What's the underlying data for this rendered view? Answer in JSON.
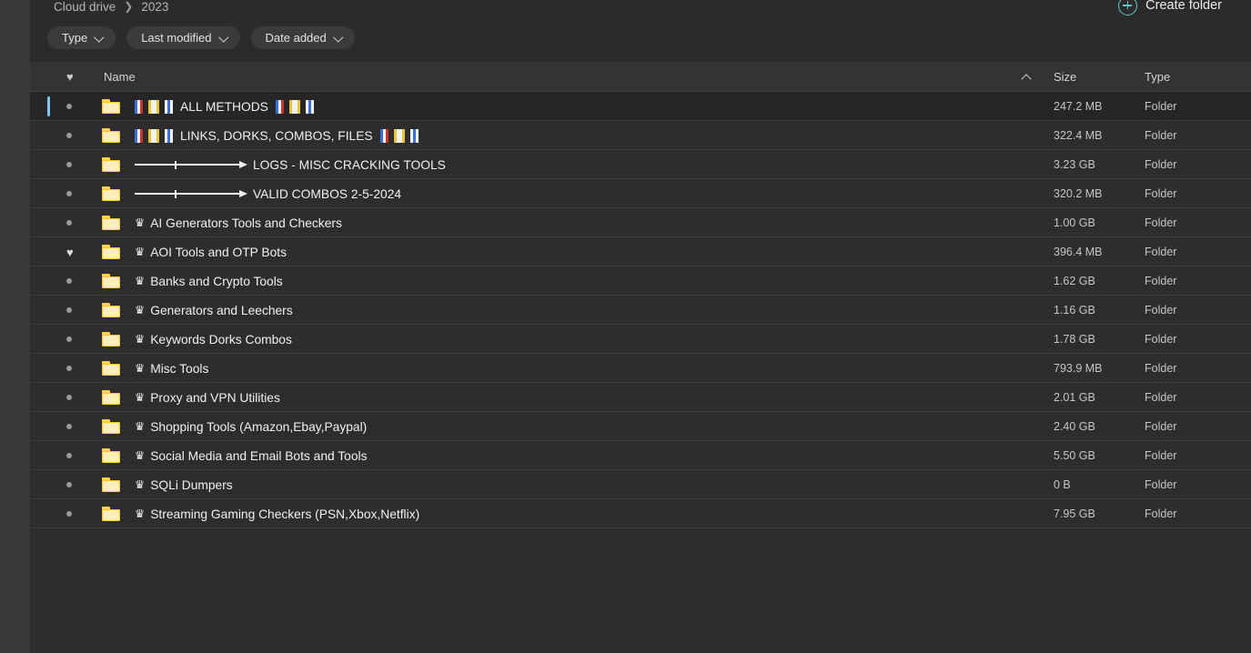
{
  "breadcrumb": {
    "items": [
      "Cloud drive",
      "2023"
    ],
    "separator": "❯"
  },
  "toolbar": {
    "create_folder_label": "Create folder",
    "create_folder_icon": "plus-circle-icon",
    "accent_color": "#5fc8c8"
  },
  "filters": [
    {
      "label": "Type",
      "icon": "chevron-down-icon"
    },
    {
      "label": "Last modified",
      "icon": "chevron-down-icon"
    },
    {
      "label": "Date added",
      "icon": "chevron-down-icon"
    }
  ],
  "table": {
    "columns": {
      "favorite": "♥",
      "name": "Name",
      "size": "Size",
      "type": "Type"
    },
    "sort": {
      "column": "Name",
      "direction": "asc",
      "icon": "caret-up-icon"
    },
    "rows": [
      {
        "name": "ALL METHODS",
        "deco": "flags",
        "favorite": false,
        "selected": true,
        "size": "247.2 MB",
        "type": "Folder"
      },
      {
        "name": "LINKS, DORKS, COMBOS, FILES",
        "deco": "flags",
        "favorite": false,
        "selected": false,
        "size": "322.4 MB",
        "type": "Folder"
      },
      {
        "name": "LOGS - MISC CRACKING TOOLS",
        "deco": "arrow",
        "favorite": false,
        "selected": false,
        "size": "3.23 GB",
        "type": "Folder"
      },
      {
        "name": "VALID COMBOS 2-5-2024",
        "deco": "arrow",
        "favorite": false,
        "selected": false,
        "size": "320.2 MB",
        "type": "Folder"
      },
      {
        "name": "AI Generators Tools and Checkers",
        "deco": "crown",
        "favorite": false,
        "selected": false,
        "size": "1.00 GB",
        "type": "Folder"
      },
      {
        "name": "AOI Tools and OTP Bots",
        "deco": "crown",
        "favorite": true,
        "selected": false,
        "size": "396.4 MB",
        "type": "Folder"
      },
      {
        "name": "Banks and Crypto Tools",
        "deco": "crown",
        "favorite": false,
        "selected": false,
        "size": "1.62 GB",
        "type": "Folder"
      },
      {
        "name": "Generators and Leechers",
        "deco": "crown",
        "favorite": false,
        "selected": false,
        "size": "1.16 GB",
        "type": "Folder"
      },
      {
        "name": "Keywords Dorks Combos",
        "deco": "crown",
        "favorite": false,
        "selected": false,
        "size": "1.78 GB",
        "type": "Folder"
      },
      {
        "name": "Misc Tools",
        "deco": "crown",
        "favorite": false,
        "selected": false,
        "size": "793.9 MB",
        "type": "Folder"
      },
      {
        "name": "Proxy and VPN Utilities",
        "deco": "crown",
        "favorite": false,
        "selected": false,
        "size": "2.01 GB",
        "type": "Folder"
      },
      {
        "name": "Shopping Tools (Amazon,Ebay,Paypal)",
        "deco": "crown",
        "favorite": false,
        "selected": false,
        "size": "2.40 GB",
        "type": "Folder"
      },
      {
        "name": "Social Media and Email Bots and Tools",
        "deco": "crown",
        "favorite": false,
        "selected": false,
        "size": "5.50 GB",
        "type": "Folder"
      },
      {
        "name": "SQLi Dumpers",
        "deco": "crown",
        "favorite": false,
        "selected": false,
        "size": "0 B",
        "type": "Folder"
      },
      {
        "name": "Streaming Gaming Checkers (PSN,Xbox,Netflix)",
        "deco": "crown",
        "favorite": false,
        "selected": false,
        "size": "7.95 GB",
        "type": "Folder"
      }
    ]
  },
  "glyphs": {
    "crown": "♛",
    "heart_filled": "♥",
    "folder_icon": "folder-icon"
  }
}
